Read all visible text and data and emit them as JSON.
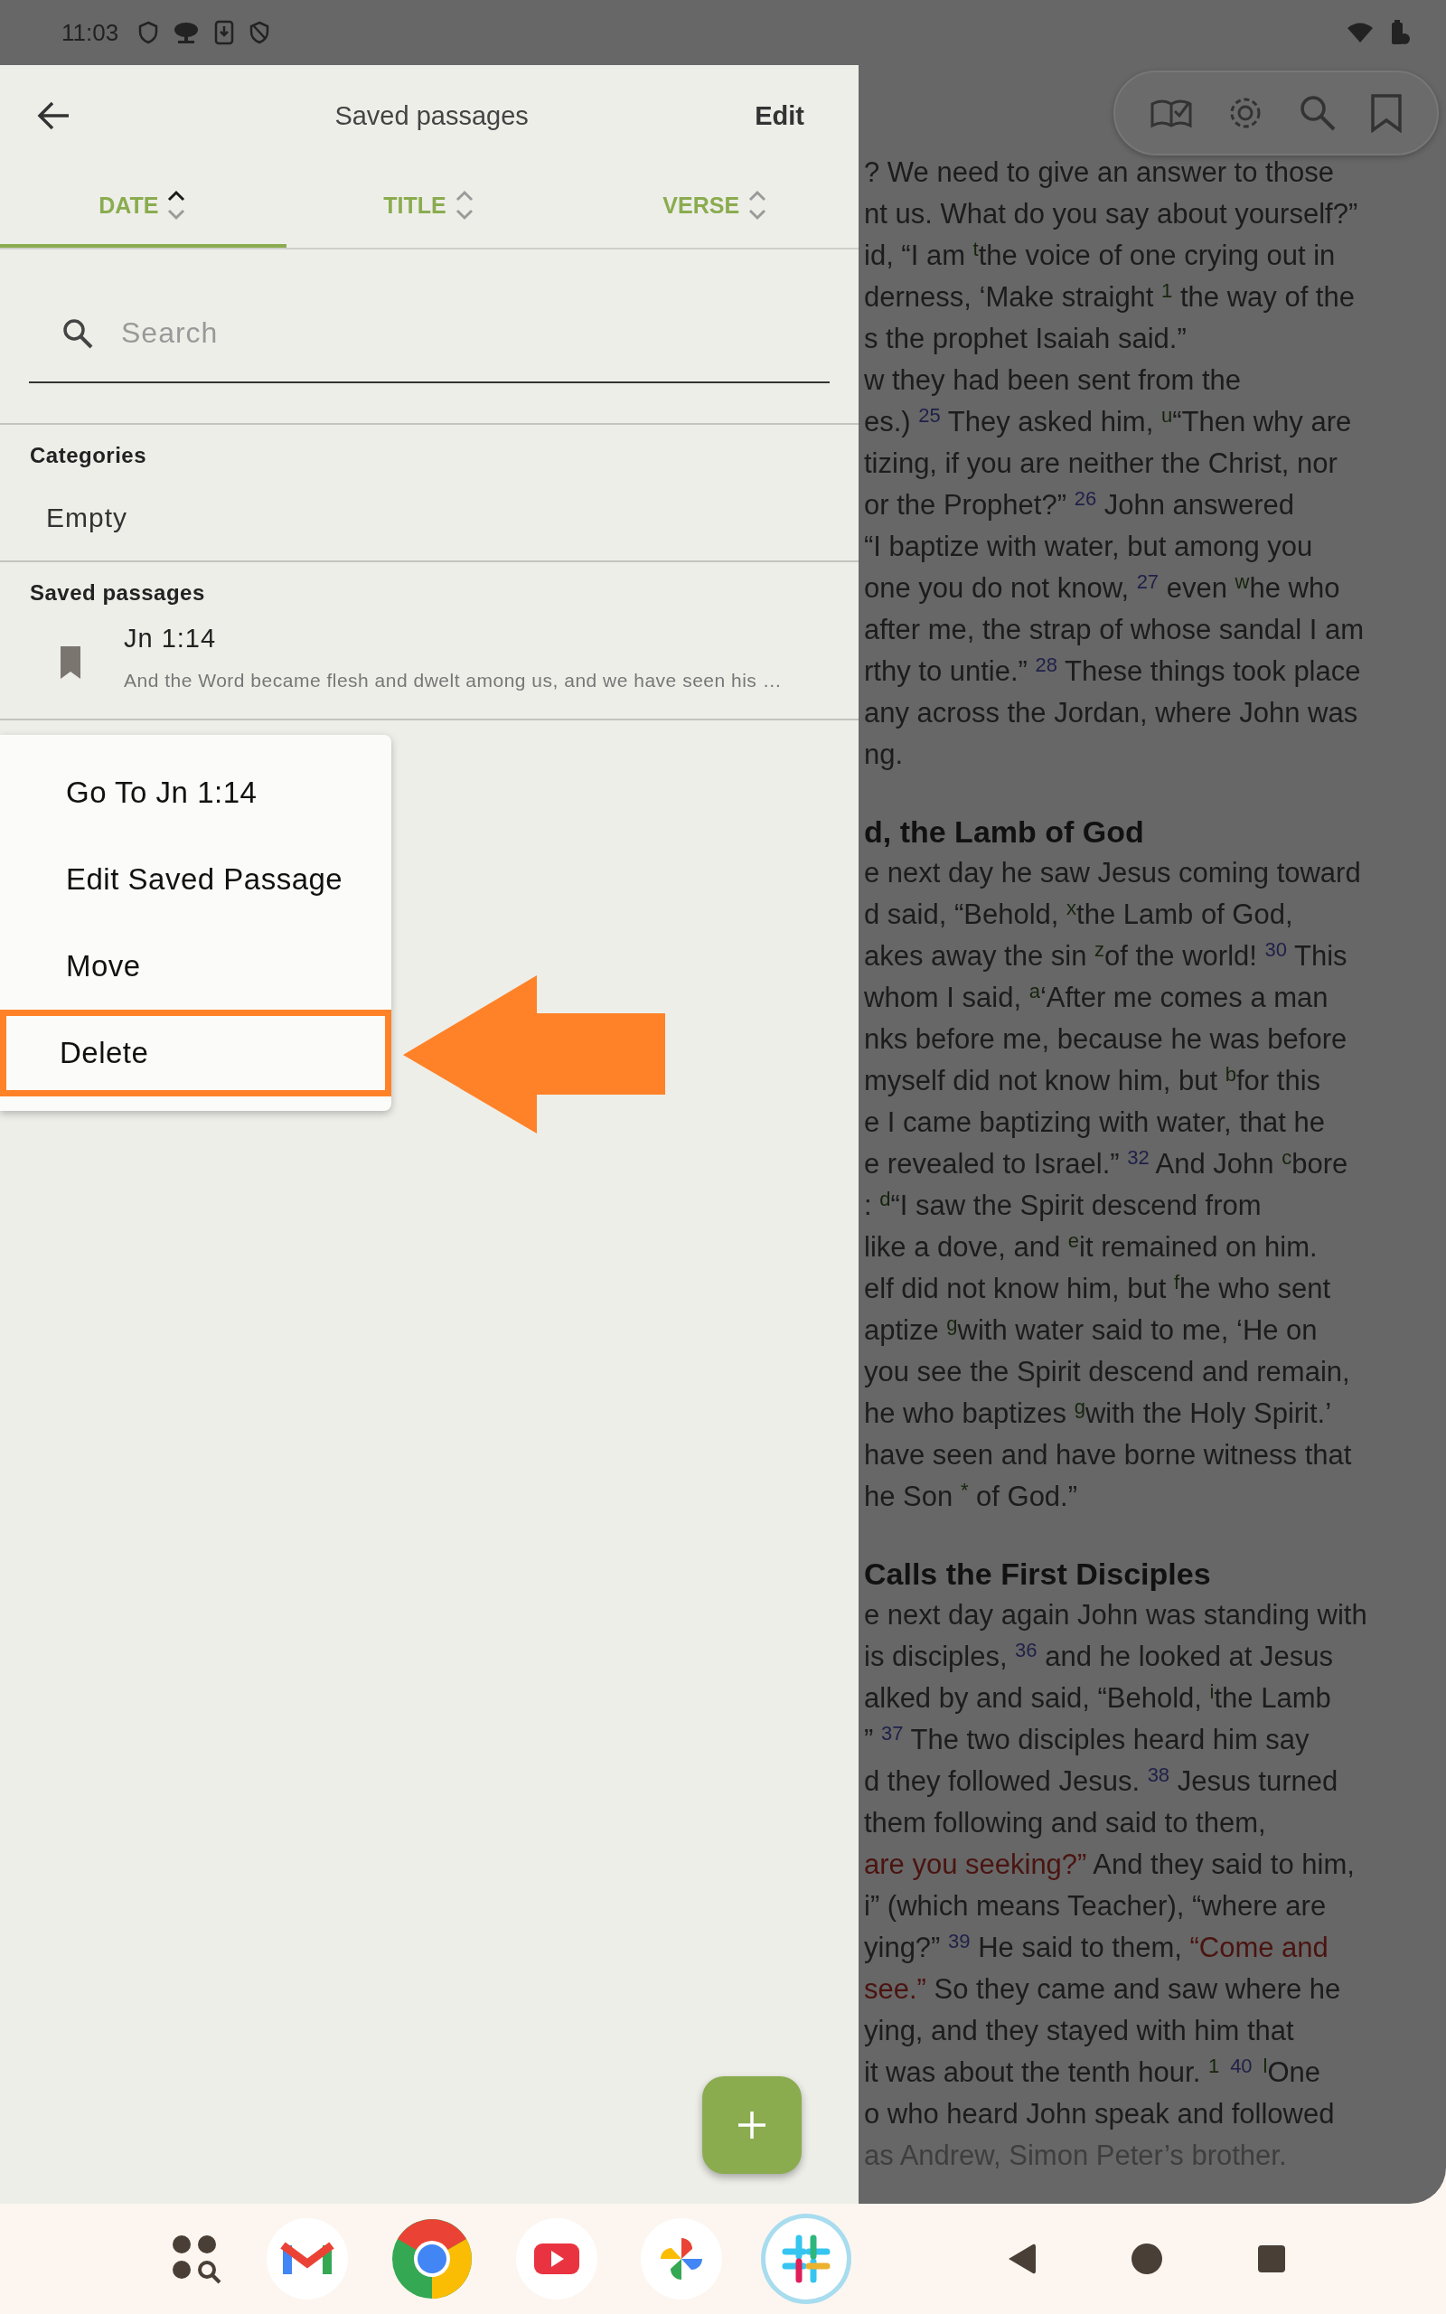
{
  "status_bar": {
    "time": "11:03"
  },
  "drawer": {
    "title": "Saved passages",
    "action": "Edit",
    "sort_tabs": [
      {
        "label": "DATE",
        "selected": true,
        "sort_ascending": true
      },
      {
        "label": "TITLE",
        "selected": false,
        "sort_ascending": false
      },
      {
        "label": "VERSE",
        "selected": false,
        "sort_ascending": false
      }
    ],
    "search": {
      "placeholder": "Search"
    },
    "sections": [
      {
        "heading": "Categories",
        "items": [
          {
            "kind": "empty",
            "text": "Empty"
          }
        ]
      },
      {
        "heading": "Saved passages",
        "items": [
          {
            "kind": "passage",
            "reference": "Jn 1:14",
            "snippet": "And the Word became flesh and dwelt among us, and we have seen his …"
          }
        ]
      }
    ],
    "context_menu": [
      {
        "label": "Go To Jn 1:14",
        "highlighted": false
      },
      {
        "label": "Edit Saved Passage",
        "highlighted": false
      },
      {
        "label": "Move",
        "highlighted": false
      },
      {
        "label": "Delete",
        "highlighted": true
      }
    ]
  },
  "reader": {
    "blocks": [
      {
        "kind": "line",
        "text": "? We need to give an answer to those"
      },
      {
        "kind": "line",
        "text": "nt us. What do you say about yourself?”"
      },
      {
        "kind": "line",
        "segments": [
          {
            "kind": "text",
            "text": "id, “I am "
          },
          {
            "kind": "note",
            "text": "t"
          },
          {
            "kind": "text",
            "text": "the voice of one crying out in"
          }
        ]
      },
      {
        "kind": "line",
        "segments": [
          {
            "kind": "text",
            "text": "derness, ‘Make straight "
          },
          {
            "kind": "note",
            "text": "1"
          },
          {
            "kind": "text",
            "text": " the way of the"
          }
        ]
      },
      {
        "kind": "line",
        "text": "s the prophet Isaiah said.”"
      },
      {
        "kind": "line",
        "text": "w they had been sent from the"
      },
      {
        "kind": "line",
        "segments": [
          {
            "kind": "text",
            "text": "es.) "
          },
          {
            "kind": "verse",
            "text": "25"
          },
          {
            "kind": "text",
            "text": " They asked him, "
          },
          {
            "kind": "note",
            "text": "u"
          },
          {
            "kind": "text",
            "text": "“Then why are"
          }
        ]
      },
      {
        "kind": "line",
        "text": "tizing, if you are neither the Christ, nor"
      },
      {
        "kind": "line",
        "segments": [
          {
            "kind": "text",
            "text": "or the Prophet?” "
          },
          {
            "kind": "verse",
            "text": "26"
          },
          {
            "kind": "text",
            "text": " John answered"
          }
        ]
      },
      {
        "kind": "line",
        "text": "“I baptize with water, but among you"
      },
      {
        "kind": "line",
        "segments": [
          {
            "kind": "text",
            "text": "one you do not know, "
          },
          {
            "kind": "verse",
            "text": "27"
          },
          {
            "kind": "text",
            "text": " even "
          },
          {
            "kind": "note",
            "text": "w"
          },
          {
            "kind": "text",
            "text": "he who"
          }
        ]
      },
      {
        "kind": "line",
        "text": "after me, the strap of whose sandal I am"
      },
      {
        "kind": "line",
        "segments": [
          {
            "kind": "text",
            "text": "rthy to untie.” "
          },
          {
            "kind": "verse",
            "text": "28"
          },
          {
            "kind": "text",
            "text": " These things took place"
          }
        ]
      },
      {
        "kind": "line",
        "text": "any across the Jordan, where John was"
      },
      {
        "kind": "line",
        "text": "ng."
      },
      {
        "kind": "heading",
        "text": "d, the Lamb of God"
      },
      {
        "kind": "line",
        "text": "e next day he saw Jesus coming toward"
      },
      {
        "kind": "line",
        "segments": [
          {
            "kind": "text",
            "text": "d said, “Behold, "
          },
          {
            "kind": "note",
            "text": "x"
          },
          {
            "kind": "text",
            "text": "the Lamb of God,"
          }
        ]
      },
      {
        "kind": "line",
        "segments": [
          {
            "kind": "text",
            "text": "akes away the sin "
          },
          {
            "kind": "note",
            "text": "z"
          },
          {
            "kind": "text",
            "text": "of the world! "
          },
          {
            "kind": "verse",
            "text": "30"
          },
          {
            "kind": "text",
            "text": " This"
          }
        ]
      },
      {
        "kind": "line",
        "segments": [
          {
            "kind": "text",
            "text": "whom I said, "
          },
          {
            "kind": "note",
            "text": "a"
          },
          {
            "kind": "text",
            "text": "‘After me comes a man"
          }
        ]
      },
      {
        "kind": "line",
        "text": "nks before me, because he was before"
      },
      {
        "kind": "line",
        "segments": [
          {
            "kind": "text",
            "text": "myself did not know him, but "
          },
          {
            "kind": "note",
            "text": "b"
          },
          {
            "kind": "text",
            "text": "for this"
          }
        ]
      },
      {
        "kind": "line",
        "text": "e I came baptizing with water, that he"
      },
      {
        "kind": "line",
        "segments": [
          {
            "kind": "text",
            "text": "e revealed to Israel.” "
          },
          {
            "kind": "verse",
            "text": "32"
          },
          {
            "kind": "text",
            "text": " And John "
          },
          {
            "kind": "note",
            "text": "c"
          },
          {
            "kind": "text",
            "text": "bore"
          }
        ]
      },
      {
        "kind": "line",
        "segments": [
          {
            "kind": "text",
            "text": ": "
          },
          {
            "kind": "note",
            "text": "d"
          },
          {
            "kind": "text",
            "text": "“I saw the Spirit descend from"
          }
        ]
      },
      {
        "kind": "line",
        "segments": [
          {
            "kind": "text",
            "text": "like a dove, and "
          },
          {
            "kind": "note",
            "text": "e"
          },
          {
            "kind": "text",
            "text": "it remained on him."
          }
        ]
      },
      {
        "kind": "line",
        "segments": [
          {
            "kind": "text",
            "text": "elf did not know him, but "
          },
          {
            "kind": "note",
            "text": "f"
          },
          {
            "kind": "text",
            "text": "he who sent"
          }
        ]
      },
      {
        "kind": "line",
        "segments": [
          {
            "kind": "text",
            "text": "aptize "
          },
          {
            "kind": "note",
            "text": "g"
          },
          {
            "kind": "text",
            "text": "with water said to me, ‘He on"
          }
        ]
      },
      {
        "kind": "line",
        "text": "you see the Spirit descend and remain,"
      },
      {
        "kind": "line",
        "segments": [
          {
            "kind": "text",
            "text": "he who baptizes "
          },
          {
            "kind": "note",
            "text": "g"
          },
          {
            "kind": "text",
            "text": "with the Holy Spirit.’"
          }
        ]
      },
      {
        "kind": "line",
        "text": "have seen and have borne witness that"
      },
      {
        "kind": "line",
        "segments": [
          {
            "kind": "text",
            "text": "he Son "
          },
          {
            "kind": "note",
            "text": "*"
          },
          {
            "kind": "text",
            "text": " of God.”"
          }
        ]
      },
      {
        "kind": "heading",
        "text": "Calls the First Disciples"
      },
      {
        "kind": "line",
        "text": "e next day again John was standing with"
      },
      {
        "kind": "line",
        "segments": [
          {
            "kind": "text",
            "text": "is disciples, "
          },
          {
            "kind": "verse",
            "text": "36"
          },
          {
            "kind": "text",
            "text": " and he looked at Jesus"
          }
        ]
      },
      {
        "kind": "line",
        "segments": [
          {
            "kind": "text",
            "text": "alked by and said, “Behold, "
          },
          {
            "kind": "note",
            "text": "i"
          },
          {
            "kind": "text",
            "text": "the Lamb"
          }
        ]
      },
      {
        "kind": "line",
        "segments": [
          {
            "kind": "text",
            "text": "” "
          },
          {
            "kind": "verse",
            "text": "37"
          },
          {
            "kind": "text",
            "text": " The two disciples heard him say"
          }
        ]
      },
      {
        "kind": "line",
        "segments": [
          {
            "kind": "text",
            "text": "d they followed Jesus. "
          },
          {
            "kind": "verse",
            "text": "38"
          },
          {
            "kind": "text",
            "text": " Jesus turned"
          }
        ]
      },
      {
        "kind": "line",
        "text": "them following and said to them,"
      },
      {
        "kind": "line",
        "segments": [
          {
            "kind": "red",
            "text": "are you seeking?”"
          },
          {
            "kind": "text",
            "text": " And they said to him,"
          }
        ]
      },
      {
        "kind": "line",
        "text": "i” (which means Teacher), “where are"
      },
      {
        "kind": "line",
        "segments": [
          {
            "kind": "text",
            "text": "ying?” "
          },
          {
            "kind": "verse",
            "text": "39"
          },
          {
            "kind": "text",
            "text": " He said to them, "
          },
          {
            "kind": "red",
            "text": "“Come and"
          }
        ]
      },
      {
        "kind": "line",
        "segments": [
          {
            "kind": "red",
            "text": "see.”"
          },
          {
            "kind": "text",
            "text": " So they came and saw where he"
          }
        ]
      },
      {
        "kind": "line",
        "text": "ying, and they stayed with him that"
      },
      {
        "kind": "line",
        "segments": [
          {
            "kind": "text",
            "text": "it was about the tenth hour. "
          },
          {
            "kind": "note",
            "text": "1"
          },
          {
            "kind": "verse",
            "text": "40"
          },
          {
            "kind": "note",
            "text": "l"
          },
          {
            "kind": "text",
            "text": "One"
          }
        ]
      },
      {
        "kind": "line",
        "text": "o who heard John speak and followed"
      },
      {
        "kind": "line",
        "text": "as Andrew, Simon Peter’s brother."
      }
    ]
  },
  "taskbar": {
    "apps": [
      {
        "kind": "app_search",
        "selected": false
      },
      {
        "kind": "mail",
        "selected": false
      },
      {
        "kind": "browser",
        "selected": false
      },
      {
        "kind": "video",
        "selected": false
      },
      {
        "kind": "photos",
        "selected": false
      },
      {
        "kind": "chat",
        "selected": true
      }
    ],
    "nav_buttons": [
      {
        "kind": "back"
      },
      {
        "kind": "home"
      },
      {
        "kind": "recents"
      }
    ]
  }
}
